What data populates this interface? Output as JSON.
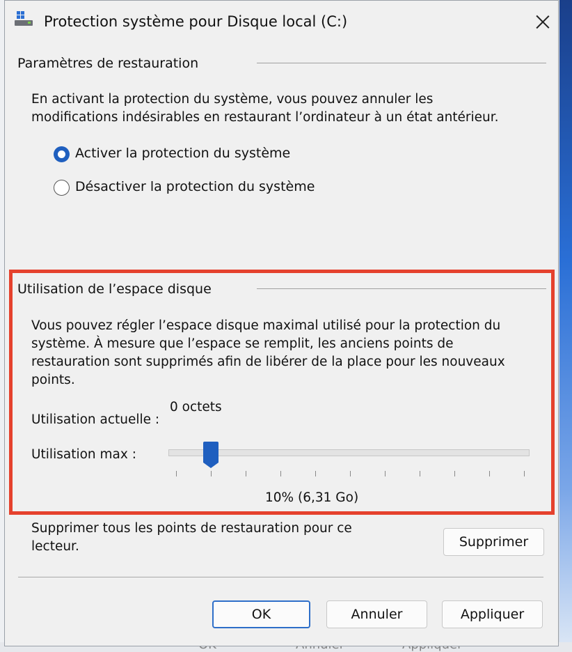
{
  "dialog": {
    "title": "Protection système pour Disque local (C:)",
    "close_label": "Fermer"
  },
  "restore_settings": {
    "heading": "Paramètres de restauration",
    "description_line1": "En activant la protection du système, vous pouvez annuler les",
    "description_line2": "modifications indésirables en restaurant l’ordinateur à un état antérieur.",
    "options": [
      {
        "label": "Activer la protection du système",
        "checked": true
      },
      {
        "label": "Désactiver la protection du système",
        "checked": false
      }
    ]
  },
  "disk_usage": {
    "heading": "Utilisation de l’espace disque",
    "description_lines": [
      "Vous pouvez régler l’espace disque maximal utilisé pour la protection du",
      "système. À mesure que l’espace se remplit, les anciens points de",
      "restauration sont supprimés afin de libérer de la place pour les nouveaux",
      "points."
    ],
    "current_usage_label": "Utilisation actuelle :",
    "current_usage_value": "0 octets",
    "max_usage_label": "Utilisation max :",
    "max_usage_percent": 10,
    "max_usage_text": "10% (6,31 Go)"
  },
  "delete_points": {
    "text_line1": "Supprimer tous les points de restauration pour ce",
    "text_line2": "lecteur.",
    "button_label": "Supprimer"
  },
  "buttons": {
    "ok": "OK",
    "cancel": "Annuler",
    "apply": "Appliquer"
  },
  "background_buttons": [
    "OK",
    "Annuler",
    "Appliquer"
  ],
  "colors": {
    "accent": "#1f5fbf",
    "highlight": "#e5412d",
    "dialog_bg": "#f0f0f0"
  }
}
